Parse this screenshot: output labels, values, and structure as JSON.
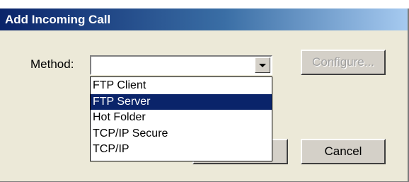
{
  "dialog": {
    "title": "Add Incoming Call",
    "method_label": "Method:",
    "method_value": "",
    "configure_label": "Configure...",
    "ok_label": "",
    "cancel_label": "Cancel",
    "dropdown_open": true
  },
  "methods": [
    {
      "label": "FTP Client",
      "selected": false
    },
    {
      "label": "FTP Server",
      "selected": true
    },
    {
      "label": "Hot Folder",
      "selected": false
    },
    {
      "label": "TCP/IP Secure",
      "selected": false
    },
    {
      "label": "TCP/IP",
      "selected": false
    }
  ],
  "colors": {
    "titlebar_start": "#0a246a",
    "titlebar_end": "#a6caf0",
    "dialog_bg": "#ece9d8",
    "selection": "#0a246a"
  },
  "icons": [
    "chevron-down-icon"
  ]
}
